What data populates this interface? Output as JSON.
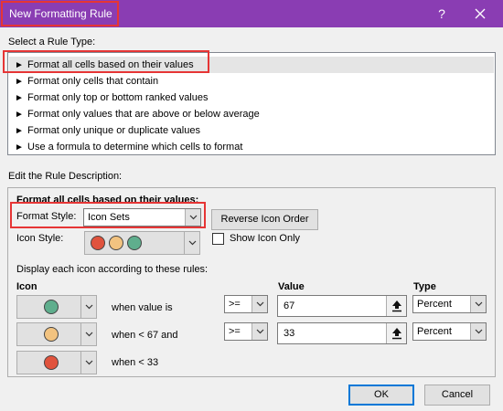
{
  "window": {
    "title": "New Formatting Rule",
    "help": "?",
    "accent_color": "#8a3db3",
    "highlight_color": "#e63535"
  },
  "rule_type": {
    "section_label": "Select a Rule Type:",
    "items": [
      {
        "label": "Format all cells based on their values",
        "selected": true
      },
      {
        "label": "Format only cells that contain",
        "selected": false
      },
      {
        "label": "Format only top or bottom ranked values",
        "selected": false
      },
      {
        "label": "Format only values that are above or below average",
        "selected": false
      },
      {
        "label": "Format only unique or duplicate values",
        "selected": false
      },
      {
        "label": "Use a formula to determine which cells to format",
        "selected": false
      }
    ]
  },
  "description": {
    "section_label": "Edit the Rule Description:",
    "heading": "Format all cells based on their values:",
    "format_style_label": "Format Style:",
    "format_style_value": "Icon Sets",
    "reverse_button": "Reverse Icon Order",
    "icon_style_label": "Icon Style:",
    "icon_style_colors": [
      "#e0533d",
      "#f2c380",
      "#5fae8d"
    ],
    "show_icon_only_label": "Show Icon Only",
    "show_icon_only_checked": false,
    "rules_intro": "Display each icon according to these rules:",
    "columns": {
      "icon": "Icon",
      "value": "Value",
      "type": "Type"
    },
    "rules": [
      {
        "icon_color": "#5fae8d",
        "condition": "when value is",
        "operator": ">=",
        "value": "67",
        "type": "Percent"
      },
      {
        "icon_color": "#f2c380",
        "condition": "when < 67 and",
        "operator": ">=",
        "value": "33",
        "type": "Percent"
      },
      {
        "icon_color": "#e0533d",
        "condition": "when < 33"
      }
    ]
  },
  "footer": {
    "ok": "OK",
    "cancel": "Cancel"
  }
}
